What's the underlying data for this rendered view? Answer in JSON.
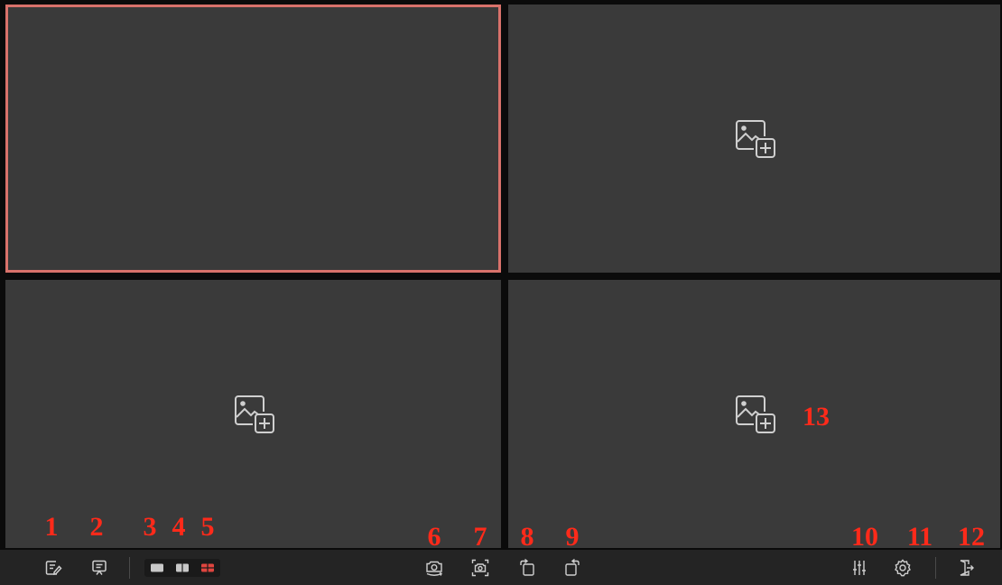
{
  "panes": [
    {
      "name": "pane-1",
      "state": "active-empty",
      "has_add_icon": false
    },
    {
      "name": "pane-2",
      "state": "empty",
      "has_add_icon": true
    },
    {
      "name": "pane-3",
      "state": "empty",
      "has_add_icon": true
    },
    {
      "name": "pane-4",
      "state": "empty",
      "has_add_icon": true
    }
  ],
  "colors": {
    "active_border": "#d9726b",
    "pane_bg": "#3a3a3a",
    "toolbar_bg": "#242424",
    "icon": "#cfcfcf",
    "selected_layout": "#e0453f",
    "marker": "#ff2a1a"
  },
  "toolbar": {
    "left": [
      {
        "id": 1,
        "icon": "note-edit-icon"
      },
      {
        "id": 2,
        "icon": "whiteboard-icon"
      }
    ],
    "layouts": [
      {
        "id": 3,
        "icon": "layout-single-icon",
        "selected": false
      },
      {
        "id": 4,
        "icon": "layout-dual-icon",
        "selected": false
      },
      {
        "id": 5,
        "icon": "layout-quad-icon",
        "selected": true
      }
    ],
    "center": [
      {
        "id": 6,
        "icon": "camera-rotate-icon"
      },
      {
        "id": 7,
        "icon": "camera-capture-icon"
      },
      {
        "id": 8,
        "icon": "rotate-left-icon"
      },
      {
        "id": 9,
        "icon": "rotate-right-icon"
      }
    ],
    "right": [
      {
        "id": 10,
        "icon": "adjustments-sliders-icon"
      },
      {
        "id": 11,
        "icon": "settings-gear-icon"
      },
      {
        "id": 12,
        "icon": "exit-door-icon"
      }
    ]
  },
  "markers": {
    "m1": "1",
    "m2": "2",
    "m3": "3",
    "m4": "4",
    "m5": "5",
    "m6": "6",
    "m7": "7",
    "m8": "8",
    "m9": "9",
    "m10": "10",
    "m11": "11",
    "m12": "12",
    "m13": "13"
  }
}
